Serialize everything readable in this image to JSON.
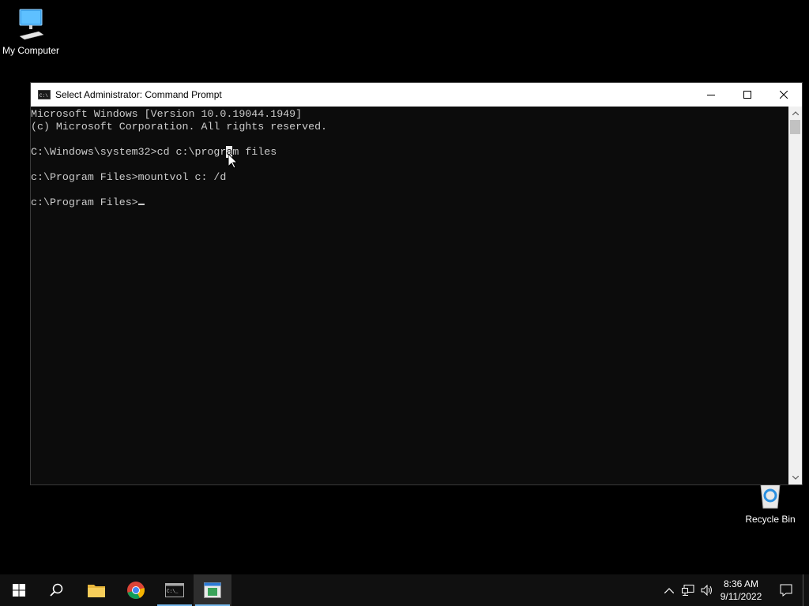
{
  "desktop": {
    "my_computer_label": "My Computer",
    "recycle_bin_label": "Recycle Bin"
  },
  "window": {
    "title": "Select Administrator: Command Prompt"
  },
  "console": {
    "line1": "Microsoft Windows [Version 10.0.19044.1949]",
    "line2": "(c) Microsoft Corporation. All rights reserved.",
    "line4_before_sel": "C:\\Windows\\system32>cd c:\\progr",
    "line4_sel": "a",
    "line4_after_sel": "m files",
    "line6": "c:\\Program Files>mountvol c: /d",
    "line8": "c:\\Program Files>"
  },
  "taskbar": {
    "apps": [
      "start-menu",
      "search",
      "file-explorer",
      "chrome",
      "command-prompt",
      "active-window"
    ],
    "clock_time": "8:36 AM",
    "clock_date": "9/11/2022"
  },
  "colors": {
    "console_bg": "#0c0c0c",
    "console_fg": "#cccccc",
    "taskbar_bg": "#101010",
    "accent": "#76b9ed"
  }
}
